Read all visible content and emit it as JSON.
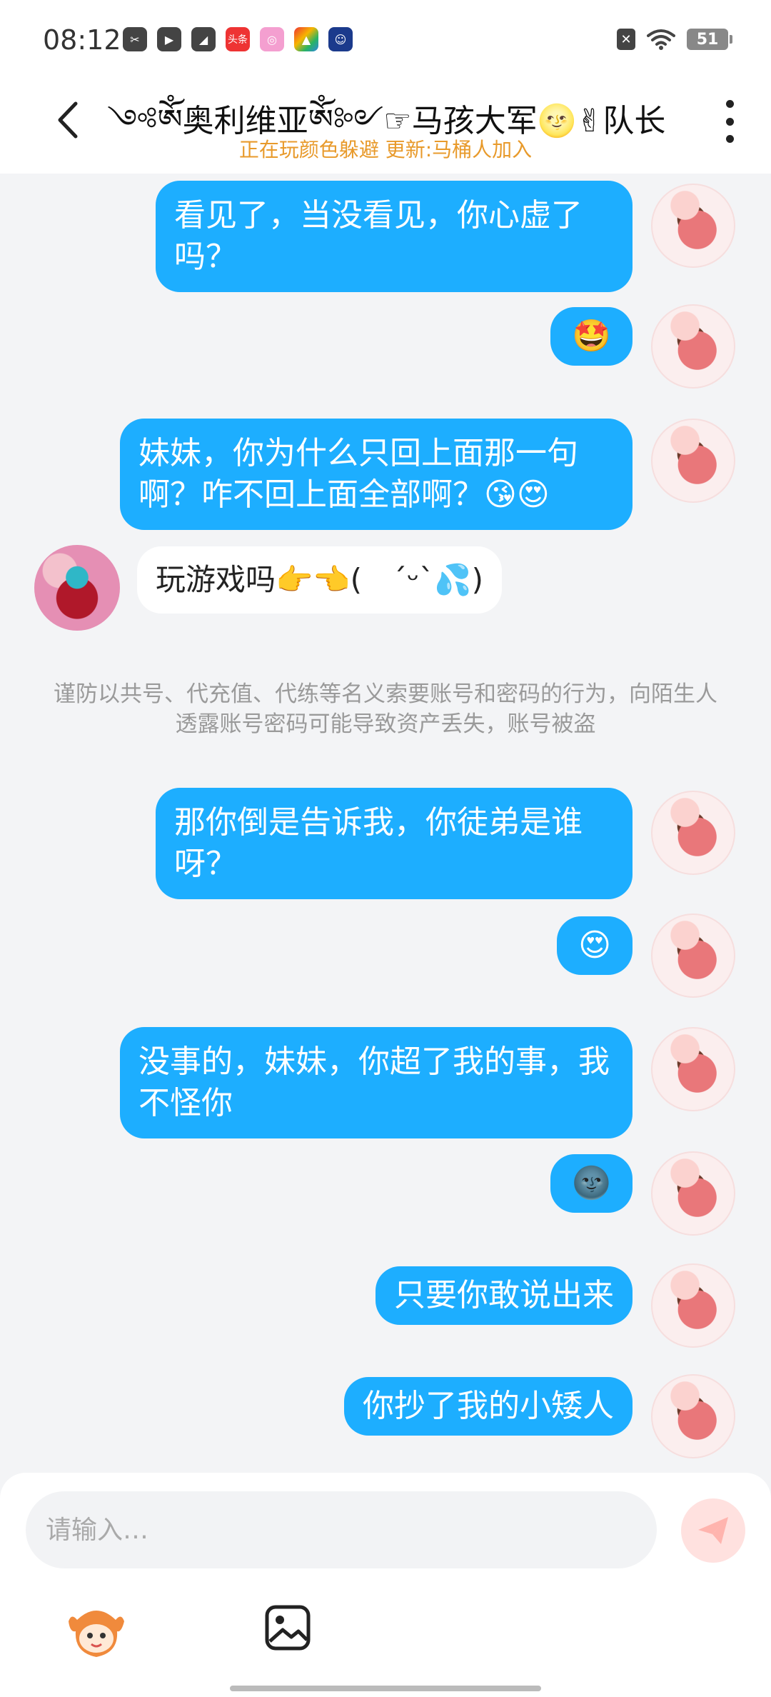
{
  "status_bar": {
    "time": "08:12",
    "notification_icons": [
      "scissors-app-icon",
      "play-icon",
      "leaf-icon",
      "toutiao-icon",
      "camera-icon",
      "multicolor-app-icon",
      "robot-icon"
    ],
    "toutiao_label": "头条",
    "battery": "51"
  },
  "header": {
    "title": "༺ༀ奥利维亚ༀ༻☞马孩大军🌝✌队长",
    "subtitle": "正在玩颜色躲避 更新:马桶人加入",
    "accent_color": "#e89a2b"
  },
  "messages": [
    {
      "side": "me",
      "text": "看见了，当没看见，你心虚了吗？"
    },
    {
      "side": "me",
      "text": "🤩"
    },
    {
      "side": "me",
      "text": "妹妹，你为什么只回上面那一句啊？咋不回上面全部啊？😘😍"
    },
    {
      "side": "other",
      "text": "玩游戏吗👉👈(　´ᵕ`💦)"
    },
    {
      "side": "notice",
      "text": "谨防以共号、代充值、代练等名义索要账号和密码的行为，向陌生人透露账号密码可能导致资产丢失，账号被盗"
    },
    {
      "side": "me",
      "text": "那你倒是告诉我，你徒弟是谁呀？"
    },
    {
      "side": "me",
      "text": "😍"
    },
    {
      "side": "me",
      "text": "没事的，妹妹，你超了我的事，我不怪你"
    },
    {
      "side": "me",
      "text": "🌚"
    },
    {
      "side": "me",
      "text": "只要你敢说出来"
    },
    {
      "side": "me",
      "text": "你抄了我的小矮人"
    }
  ],
  "composer": {
    "placeholder": "请输入…",
    "send_color": "#ffe1df"
  },
  "colors": {
    "my_bubble": "#1daeff",
    "other_bubble": "#ffffff",
    "background": "#f3f4f6"
  }
}
